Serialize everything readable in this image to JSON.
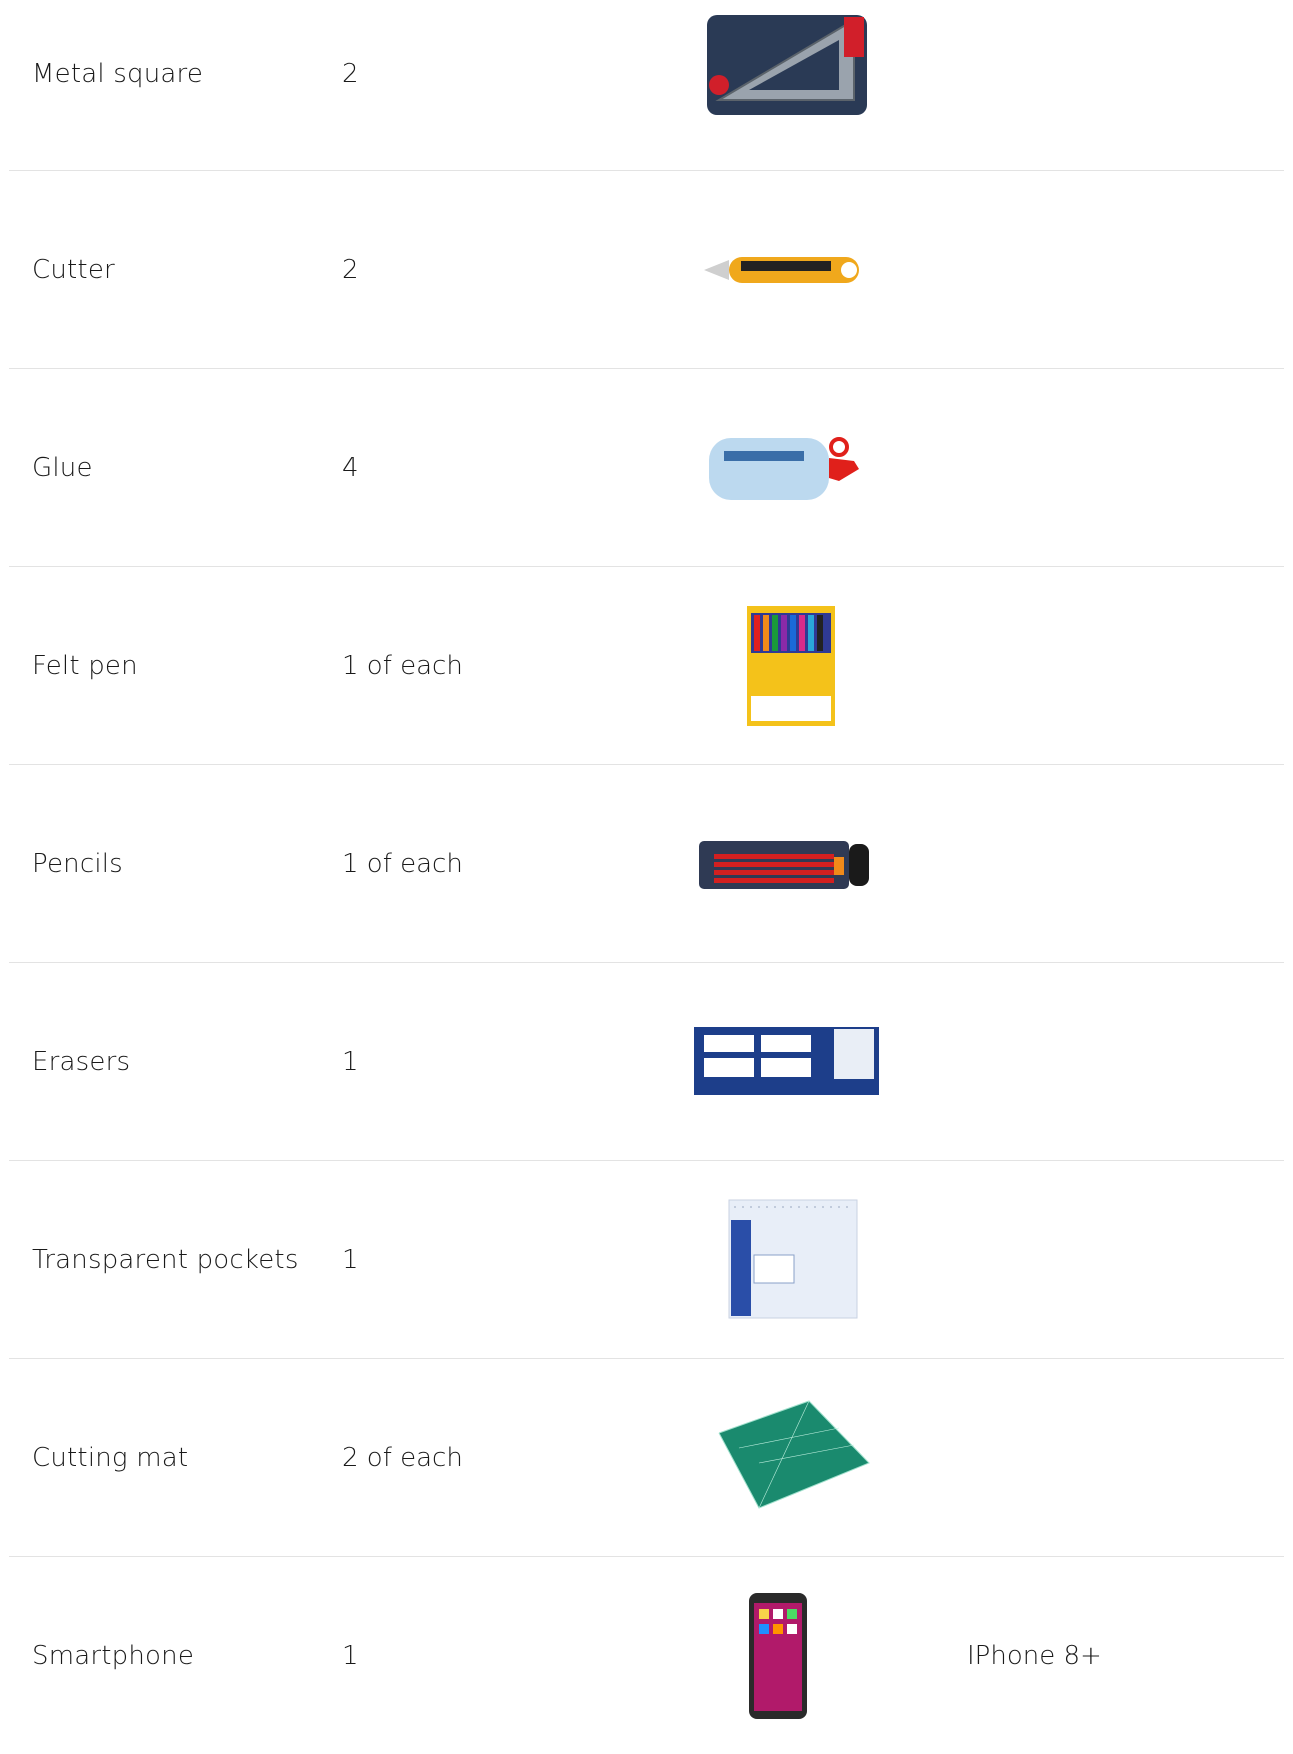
{
  "items": [
    {
      "name": "Metal square",
      "quantity": "2",
      "image": "metal-square-image",
      "note": ""
    },
    {
      "name": "Cutter",
      "quantity": "2",
      "image": "cutter-image",
      "note": ""
    },
    {
      "name": "Glue",
      "quantity": "4",
      "image": "glue-image",
      "note": ""
    },
    {
      "name": "Felt pen",
      "quantity": "1 of each",
      "image": "felt-pen-image",
      "note": ""
    },
    {
      "name": "Pencils",
      "quantity": "1 of each",
      "image": "pencils-image",
      "note": ""
    },
    {
      "name": "Erasers",
      "quantity": "1",
      "image": "erasers-image",
      "note": ""
    },
    {
      "name": "Transparent pockets",
      "quantity": "1",
      "image": "transparent-pockets-image",
      "note": ""
    },
    {
      "name": "Cutting mat",
      "quantity": "2 of each",
      "image": "cutting-mat-image",
      "note": ""
    },
    {
      "name": "Smartphone",
      "quantity": "1",
      "image": "smartphone-image",
      "note": "IPhone 8+"
    }
  ],
  "colors": {
    "divider": "#e3e3e3",
    "text": "#1a1a1a"
  }
}
